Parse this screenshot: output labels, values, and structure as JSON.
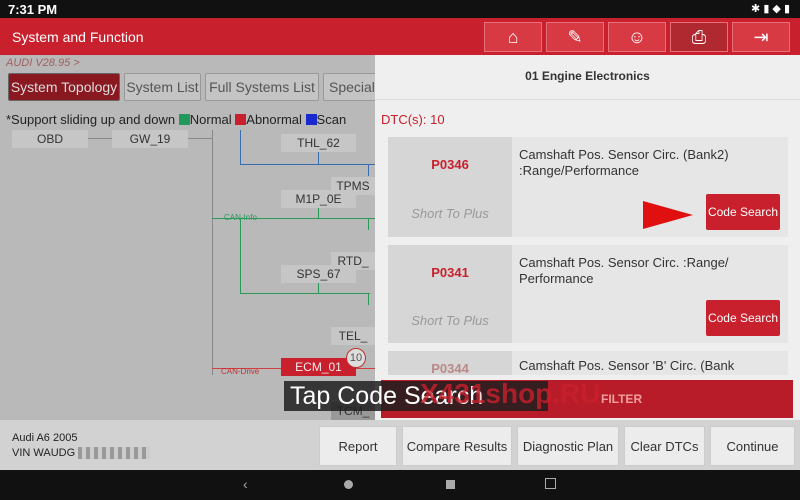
{
  "status": {
    "time": "7:31 PM"
  },
  "header": {
    "title": "System and Function",
    "icons": [
      "home-icon",
      "edit-report-icon",
      "support-icon",
      "print-icon",
      "exit-icon"
    ]
  },
  "left": {
    "breadcrumb": "AUDI V28.95 >",
    "tabs": [
      "System Topology",
      "System List",
      "Full Systems List",
      "Special"
    ],
    "legend": {
      "note": "*Support sliding up and down",
      "normal": "Normal",
      "abnormal": "Abnormal",
      "scan": "Scan"
    },
    "nodes": {
      "obd": "OBD",
      "gw": "GW_19",
      "thl": "THL_62",
      "tpms": "TPMS",
      "m1p": "M1P_0E",
      "rtd": "RTD_",
      "sps": "SPS_67",
      "tel": "TEL_",
      "ecm": "ECM_01",
      "tcm": "TCM_",
      "ecm_badge": "10"
    },
    "buses": {
      "info": "CAN-Info",
      "drive": "CAN-Drive"
    },
    "vehicle": {
      "model": "Audi A6  2005",
      "vin": "VIN WAUDG"
    }
  },
  "colors": {
    "normal": "#22995a",
    "abnormal": "#c8202c",
    "scan": "#1a2ad0"
  },
  "panel": {
    "title": "01 Engine Electronics",
    "dtc_count": "DTC(s): 10",
    "dtcs": [
      {
        "code": "P0346",
        "status": "Short To Plus",
        "desc": "Camshaft Pos. Sensor Circ. (Bank2) :Range/Performance",
        "button": "Code Search"
      },
      {
        "code": "P0341",
        "status": "Short To Plus",
        "desc": "Camshaft Pos. Sensor Circ. :Range/ Performance",
        "button": "Code Search"
      },
      {
        "code": "P0344",
        "desc": "Camshaft Pos. Sensor 'B' Circ. (Bank"
      }
    ],
    "filter": "FILTER"
  },
  "overlay": {
    "caption": "Tap Code Search",
    "watermark": "X431shop.RU"
  },
  "actions": [
    "Report",
    "Compare Results",
    "Diagnostic Plan",
    "Clear DTCs",
    "Continue"
  ]
}
